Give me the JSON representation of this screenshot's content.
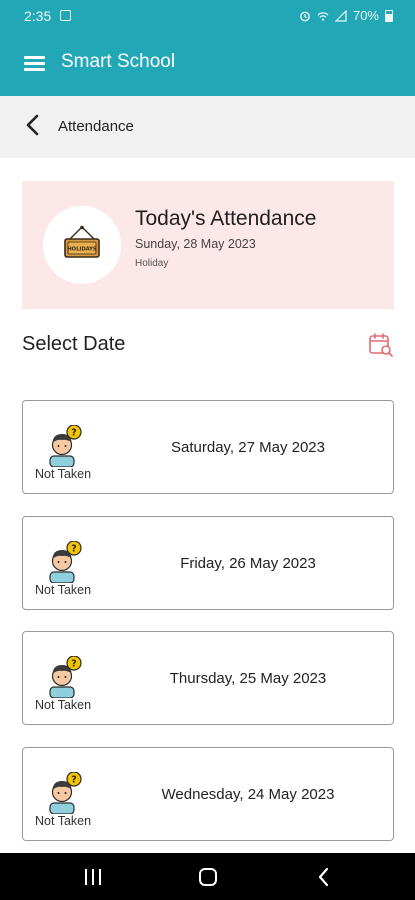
{
  "status_bar": {
    "time": "2:35",
    "battery": "70%"
  },
  "app_bar": {
    "title": "Smart School",
    "menu_icon": "hamburger-menu-icon"
  },
  "sub_header": {
    "back_icon": "chevron-left-icon",
    "title": "Attendance"
  },
  "today": {
    "title": "Today's Attendance",
    "date": "Sunday, 28 May 2023",
    "status": "Holiday",
    "icon": "holiday-sign-icon",
    "sign_text": "HOLIDAYS",
    "background": "#fde8e9"
  },
  "select_date": {
    "label": "Select Date",
    "icon": "calendar-search-icon"
  },
  "records": [
    {
      "status": "Not Taken",
      "date": "Saturday, 27 May 2023"
    },
    {
      "status": "Not Taken",
      "date": "Friday, 26 May 2023"
    },
    {
      "status": "Not Taken",
      "date": "Thursday, 25 May 2023"
    },
    {
      "status": "Not Taken",
      "date": "Wednesday, 24 May 2023"
    }
  ],
  "colors": {
    "primary": "#21a7b6",
    "accent": "#e36b72",
    "question_badge": "#f5c400"
  }
}
